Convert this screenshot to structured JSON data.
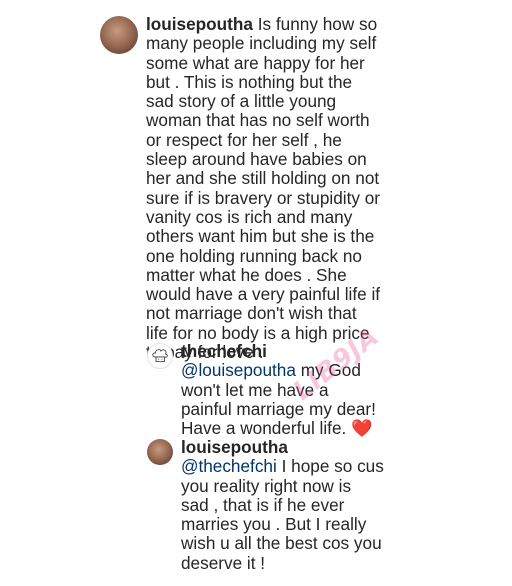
{
  "comments": [
    {
      "username": "louisepoutha",
      "text_lines": [
        "Is funny how so",
        "many people including my self",
        "some what are happy for her",
        "but . This is nothing but the",
        "sad story of a little young",
        "woman that has no self worth",
        "or respect for her self , he",
        "sleep around have babies on",
        "her and she still holding on not",
        "sure if is bravery or stupidity or",
        "vanity cos is rich and many",
        "others want him but she is the",
        "one holding running  back no",
        "matter what he does . She",
        "would have a very painful life if",
        "not marriage don't wish that",
        "life for no body is a high price",
        "to pay for love ."
      ],
      "avatar_icon": "profile-photo"
    },
    {
      "username": "thechefchi",
      "mention": "@louisepoutha",
      "text_after_mention": " my God",
      "text_lines": [
        "won't let me have a",
        "painful marriage my dear!",
        "Have a wonderful life. "
      ],
      "emoji": "❤️",
      "avatar_icon": "chef-hat-icon"
    },
    {
      "username": "louisepoutha",
      "mention": "@thechefchi",
      "text_after_mention": " I hope so cus",
      "text_lines": [
        "you reality right now is",
        "sad , that is if he ever",
        "marries you . But I really",
        "wish u all the best cos you",
        "deserve it !"
      ],
      "avatar_icon": "profile-photo"
    }
  ],
  "watermark": {
    "text": "LIB9JA"
  },
  "colors": {
    "text": "#262626",
    "mention": "#003569",
    "heart": "#ed4956",
    "watermark": "#e8468c"
  }
}
